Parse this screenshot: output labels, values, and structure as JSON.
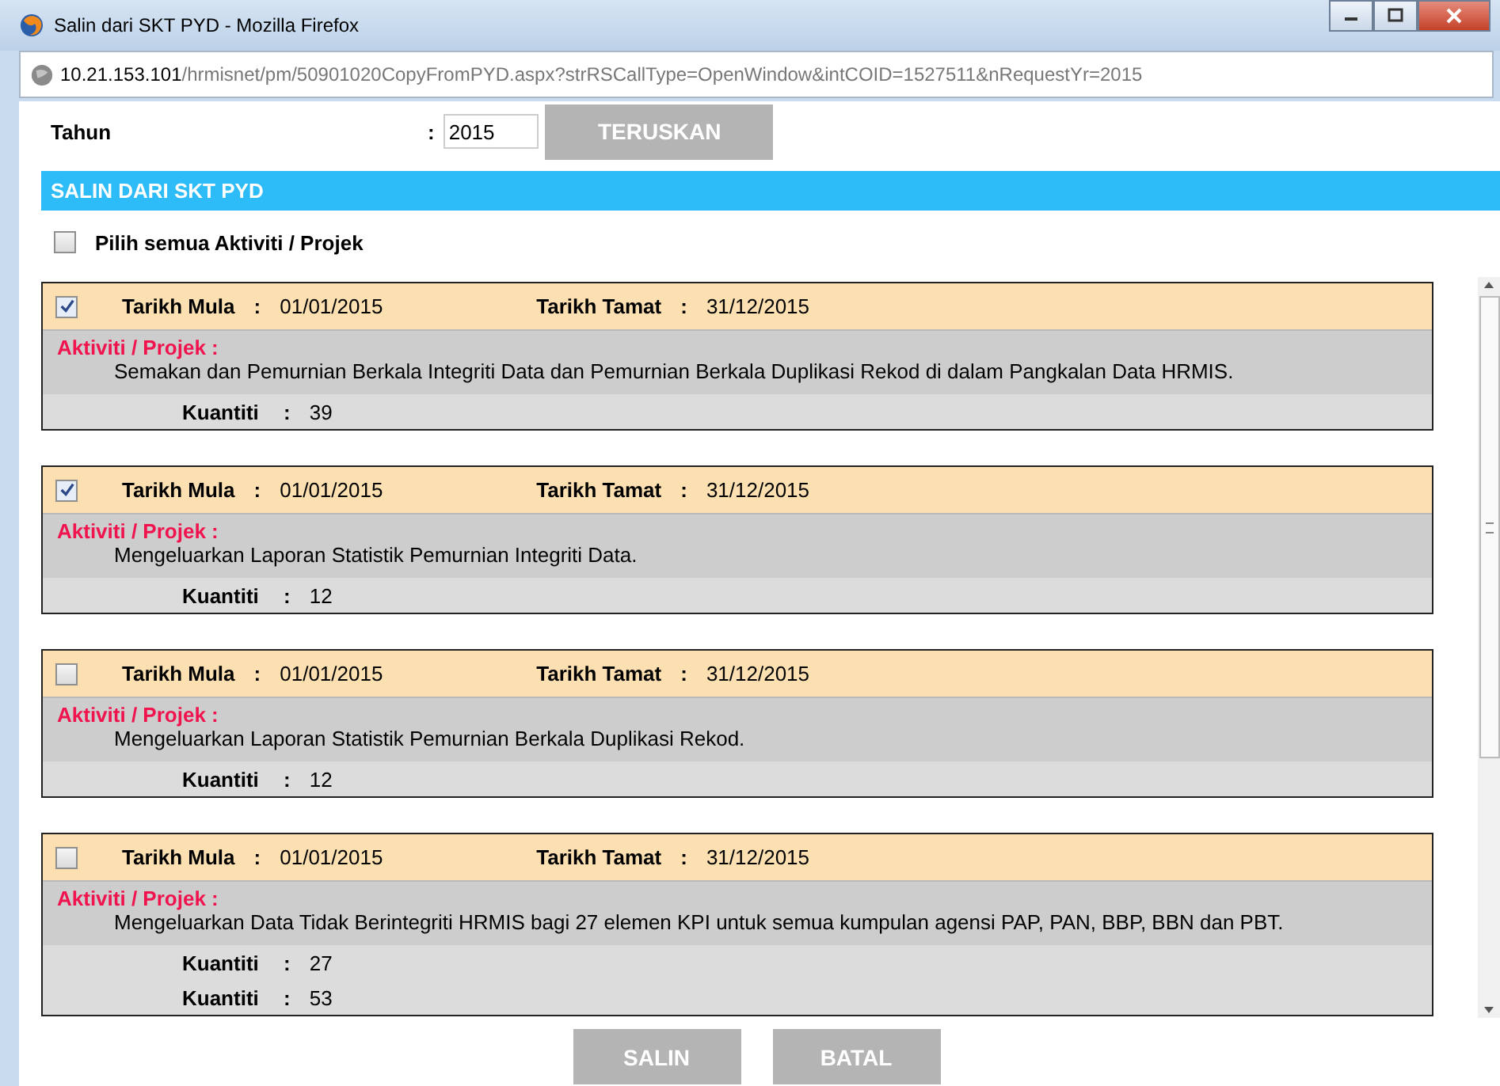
{
  "window": {
    "title": "Salin dari SKT PYD - Mozilla Firefox"
  },
  "address_bar": {
    "host": "10.21.153.101",
    "path": "/hrmisnet/pm/50901020CopyFromPYD.aspx?strRSCallType=OpenWindow&intCOID=1527511&nRequestYr=2015"
  },
  "year": {
    "label": "Tahun",
    "separator": ":",
    "value": "2015",
    "button": "TERUSKAN"
  },
  "section_title": "SALIN DARI SKT PYD",
  "select_all": {
    "label": "Pilih semua Aktiviti / Projek",
    "checked": false
  },
  "activities": [
    {
      "checked": true,
      "start_label": "Tarikh Mula",
      "start_separator": ":",
      "start_date": "01/01/2015",
      "end_label": "Tarikh Tamat",
      "end_separator": ":",
      "end_date": "31/12/2015",
      "activity_label": "Aktiviti / Projek :",
      "description": "Semakan dan Pemurnian Berkala Integriti Data dan Pemurnian Berkala Duplikasi Rekod di dalam Pangkalan Data HRMIS.",
      "quantities": [
        {
          "label": "Kuantiti",
          "separator": ":",
          "value": "39"
        }
      ]
    },
    {
      "checked": true,
      "start_label": "Tarikh Mula",
      "start_separator": ":",
      "start_date": "01/01/2015",
      "end_label": "Tarikh Tamat",
      "end_separator": ":",
      "end_date": "31/12/2015",
      "activity_label": "Aktiviti / Projek :",
      "description": "Mengeluarkan Laporan Statistik Pemurnian Integriti Data.",
      "quantities": [
        {
          "label": "Kuantiti",
          "separator": ":",
          "value": "12"
        }
      ]
    },
    {
      "checked": false,
      "start_label": "Tarikh Mula",
      "start_separator": ":",
      "start_date": "01/01/2015",
      "end_label": "Tarikh Tamat",
      "end_separator": ":",
      "end_date": "31/12/2015",
      "activity_label": "Aktiviti / Projek :",
      "description": "Mengeluarkan Laporan Statistik Pemurnian Berkala Duplikasi Rekod.",
      "quantities": [
        {
          "label": "Kuantiti",
          "separator": ":",
          "value": "12"
        }
      ]
    },
    {
      "checked": false,
      "start_label": "Tarikh Mula",
      "start_separator": ":",
      "start_date": "01/01/2015",
      "end_label": "Tarikh Tamat",
      "end_separator": ":",
      "end_date": "31/12/2015",
      "activity_label": "Aktiviti / Projek :",
      "description": "Mengeluarkan Data Tidak Berintegriti HRMIS bagi 27 elemen KPI untuk semua kumpulan agensi PAP, PAN, BBP, BBN dan PBT.",
      "quantities": [
        {
          "label": "Kuantiti",
          "separator": ":",
          "value": "27"
        },
        {
          "label": "Kuantiti",
          "separator": ":",
          "value": "53"
        }
      ]
    }
  ],
  "buttons": [
    "SALIN",
    "BATAL"
  ]
}
